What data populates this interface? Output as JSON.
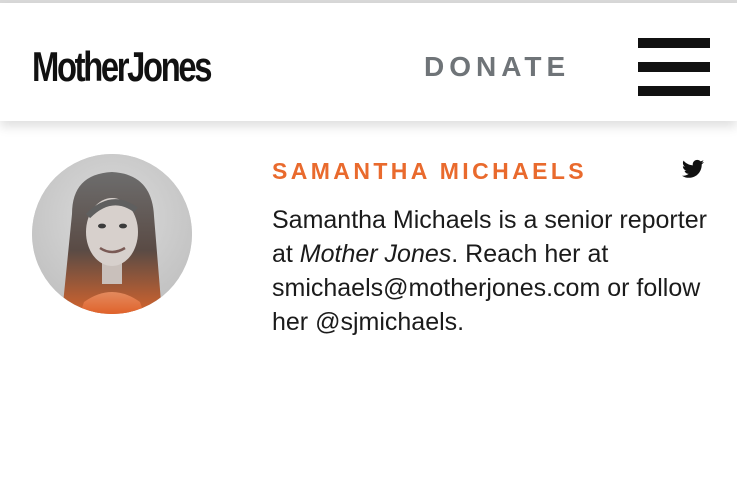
{
  "header": {
    "logo_text": "MotherJones",
    "donate_label": "DONATE",
    "menu_icon": "hamburger-menu-icon"
  },
  "author": {
    "name": "SAMANTHA MICHAELS",
    "twitter_icon": "twitter-icon",
    "bio_part1": "Samantha Michaels is a senior reporter at ",
    "bio_publication": "Mother Jones",
    "bio_part2": ". Reach her at ",
    "email": "smichaels@motherjones.com",
    "bio_part3": " or follow her ",
    "handle": "@sjmichaels",
    "bio_part4": "."
  },
  "colors": {
    "accent": "#e96a2d",
    "donate": "#6f7478",
    "text": "#1b1b1b"
  }
}
